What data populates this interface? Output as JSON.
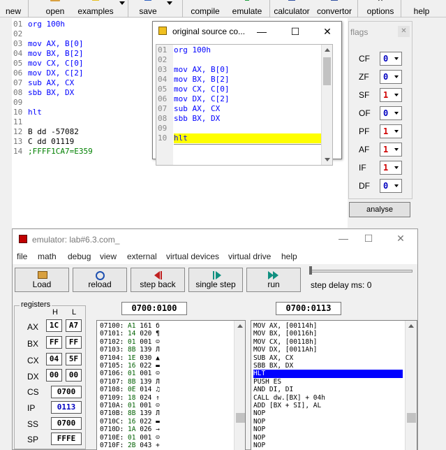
{
  "toolbar": {
    "new": "new",
    "open": "open",
    "examples": "examples",
    "save": "save",
    "compile": "compile",
    "emulate": "emulate",
    "calculator": "calculator",
    "convertor": "convertor",
    "options": "options",
    "help": "help"
  },
  "editor": {
    "line_numbers": [
      "01",
      "02",
      "03",
      "04",
      "05",
      "06",
      "07",
      "08",
      "09",
      "10",
      "11",
      "12",
      "13",
      "14"
    ],
    "lines": [
      "org 100h",
      "",
      "mov AX, B[0]",
      "mov BX, B[2]",
      "mov CX, C[0]",
      "mov DX, C[2]",
      "sub AX, CX",
      "sbb BX, DX",
      "",
      "hlt",
      "",
      "B dd -57082",
      "C dd 01119",
      ";FFFF1CA7=E359"
    ]
  },
  "source_window": {
    "title": "original source co...",
    "minimize": "—",
    "maximize": "☐",
    "close": "✕",
    "line_numbers": [
      "01",
      "02",
      "03",
      "04",
      "05",
      "06",
      "07",
      "08",
      "09",
      "10"
    ],
    "lines": [
      "org 100h",
      "",
      "mov AX, B[0]",
      "mov BX, B[2]",
      "mov CX, C[0]",
      "mov DX, C[2]",
      "sub AX, CX",
      "sbb BX, DX",
      "",
      "hlt"
    ],
    "highlight_color": "#ffff00"
  },
  "flags": {
    "title": "flags",
    "close": "✕",
    "items": [
      {
        "name": "CF",
        "value": "0"
      },
      {
        "name": "ZF",
        "value": "0"
      },
      {
        "name": "SF",
        "value": "1"
      },
      {
        "name": "OF",
        "value": "0"
      },
      {
        "name": "PF",
        "value": "1"
      },
      {
        "name": "AF",
        "value": "1"
      },
      {
        "name": "IF",
        "value": "1"
      },
      {
        "name": "DF",
        "value": "0"
      }
    ],
    "analyse": "analyse"
  },
  "emulator": {
    "title": "emulator: lab#6.3.com_",
    "minimize": "—",
    "maximize": "☐",
    "close": "✕",
    "menu": [
      "file",
      "math",
      "debug",
      "view",
      "external",
      "virtual devices",
      "virtual drive",
      "help"
    ],
    "buttons": {
      "load": "Load",
      "reload": "reload",
      "step_back": "step back",
      "single_step": "single step",
      "run": "run"
    },
    "step_delay": "step delay ms: 0",
    "registers_label": "registers",
    "h_label": "H",
    "l_label": "L",
    "regs": [
      {
        "name": "AX",
        "h": "1C",
        "l": "A7"
      },
      {
        "name": "BX",
        "h": "FF",
        "l": "FF"
      },
      {
        "name": "CX",
        "h": "04",
        "l": "5F"
      },
      {
        "name": "DX",
        "h": "00",
        "l": "00"
      }
    ],
    "seg_regs": [
      {
        "name": "CS",
        "value": "0700"
      },
      {
        "name": "IP",
        "value": "0113"
      },
      {
        "name": "SS",
        "value": "0700"
      },
      {
        "name": "SP",
        "value": "FFFE"
      }
    ],
    "mem_address": "0700:0100",
    "dis_address": "0700:0113",
    "memory": [
      {
        "addr": "07100:",
        "hex": "A1",
        "dec": "161",
        "ch": "б"
      },
      {
        "addr": "07101:",
        "hex": "14",
        "dec": "020",
        "ch": "¶"
      },
      {
        "addr": "07102:",
        "hex": "01",
        "dec": "001",
        "ch": "☺"
      },
      {
        "addr": "07103:",
        "hex": "8B",
        "dec": "139",
        "ch": "Л"
      },
      {
        "addr": "07104:",
        "hex": "1E",
        "dec": "030",
        "ch": "▲"
      },
      {
        "addr": "07105:",
        "hex": "16",
        "dec": "022",
        "ch": "▬"
      },
      {
        "addr": "07106:",
        "hex": "01",
        "dec": "001",
        "ch": "☺"
      },
      {
        "addr": "07107:",
        "hex": "8B",
        "dec": "139",
        "ch": "Л"
      },
      {
        "addr": "07108:",
        "hex": "0E",
        "dec": "014",
        "ch": "♫"
      },
      {
        "addr": "07109:",
        "hex": "18",
        "dec": "024",
        "ch": "↑"
      },
      {
        "addr": "0710A:",
        "hex": "01",
        "dec": "001",
        "ch": "☺"
      },
      {
        "addr": "0710B:",
        "hex": "8B",
        "dec": "139",
        "ch": "Л"
      },
      {
        "addr": "0710C:",
        "hex": "16",
        "dec": "022",
        "ch": "▬"
      },
      {
        "addr": "0710D:",
        "hex": "1A",
        "dec": "026",
        "ch": "→"
      },
      {
        "addr": "0710E:",
        "hex": "01",
        "dec": "001",
        "ch": "☺"
      },
      {
        "addr": "0710F:",
        "hex": "2B",
        "dec": "043",
        "ch": "+"
      }
    ],
    "disassembly": [
      "MOV AX, [00114h]",
      "MOV BX, [00116h]",
      "MOV CX, [00118h]",
      "MOV DX, [0011Ah]",
      "SUB AX, CX",
      "SBB BX, DX",
      "HLT",
      "PUSH ES",
      "AND DI, DI",
      "CALL dw.[BX] + 04h",
      "ADD [BX + SI], AL",
      "NOP",
      "NOP",
      "NOP",
      "NOP",
      "NOP"
    ],
    "selected_index": 6,
    "selection_color": "#0000ff"
  }
}
